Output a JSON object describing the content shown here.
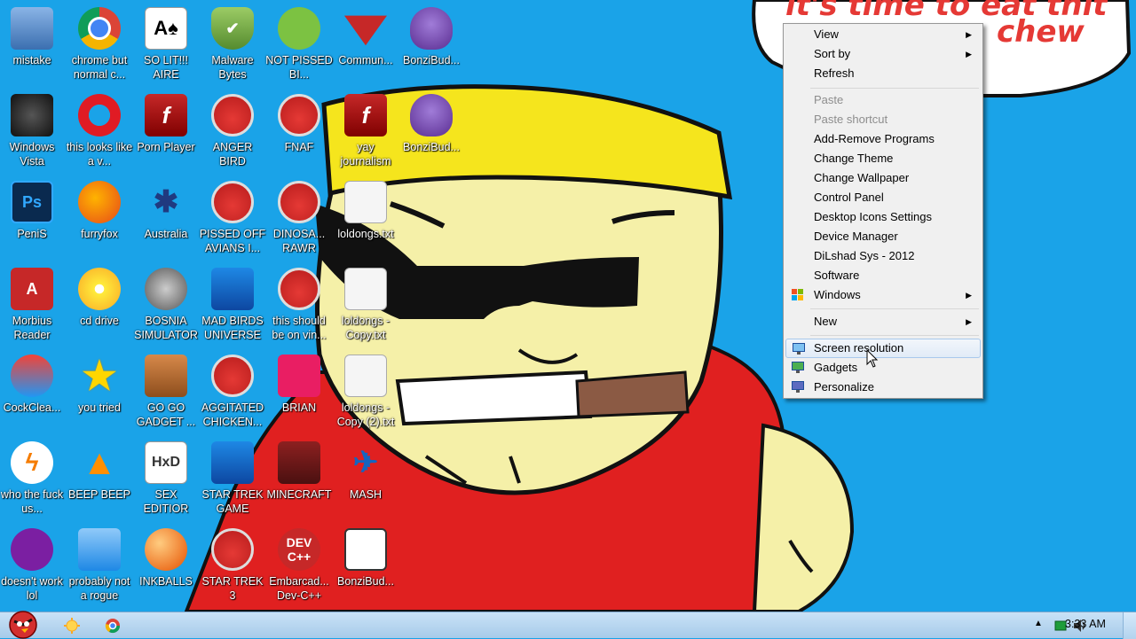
{
  "wallpaper": {
    "speech_line1": "it's time to eat thit",
    "speech_line2": "chew"
  },
  "desktop_icons": [
    {
      "label": "mistake"
    },
    {
      "label": "chrome but normal c..."
    },
    {
      "label": "SO LIT!!! AIRE"
    },
    {
      "label": "Malware Bytes"
    },
    {
      "label": "NOT PISSED BI..."
    },
    {
      "label": "Commun..."
    },
    {
      "label": "BonziBud..."
    },
    {
      "label": "Windows Vista"
    },
    {
      "label": "this looks like a v..."
    },
    {
      "label": "Porn Player"
    },
    {
      "label": "ANGER BIRD"
    },
    {
      "label": "FNAF"
    },
    {
      "label": "yay journalism"
    },
    {
      "label": "BonziBud..."
    },
    {
      "label": "PeniS"
    },
    {
      "label": "furryfox"
    },
    {
      "label": "Australia"
    },
    {
      "label": "PISSED OFF AVIANS I..."
    },
    {
      "label": "DINOSA... RAWR"
    },
    {
      "label": "loldongs.txt"
    },
    {
      "label": "Morbius Reader"
    },
    {
      "label": "cd drive"
    },
    {
      "label": "BOSNIA SIMULATOR"
    },
    {
      "label": "MAD BIRDS UNIVERSE"
    },
    {
      "label": "this should be on vin..."
    },
    {
      "label": "loldongs - Copy.txt"
    },
    {
      "label": "CockClea..."
    },
    {
      "label": "you tried"
    },
    {
      "label": "GO GO GADGET ..."
    },
    {
      "label": "AGGITATED CHICKEN..."
    },
    {
      "label": "BRIAN"
    },
    {
      "label": "loldongs - Copy (2).txt"
    },
    {
      "label": "who the fuck us..."
    },
    {
      "label": "BEEP BEEP"
    },
    {
      "label": "SEX EDITIOR"
    },
    {
      "label": "STAR TREK GAME"
    },
    {
      "label": "MINECRAFT"
    },
    {
      "label": "MASH"
    },
    {
      "label": "doesn't work lol"
    },
    {
      "label": "probably not a rogue"
    },
    {
      "label": "INKBALLS"
    },
    {
      "label": "STAR TREK 3"
    },
    {
      "label": "Embarcad... Dev-C++"
    },
    {
      "label": "BonziBud..."
    }
  ],
  "icon_glyphs": {
    "ps": "Ps",
    "pdf": "A",
    "hxd": "HxD",
    "dev": "DEV C++",
    "card": "A♠",
    "star": "★",
    "cone": "▲",
    "lightning": "ϟ",
    "flash": "f",
    "spider": "✱",
    "ship": "✈"
  },
  "context_menu": {
    "view": "View",
    "sort_by": "Sort by",
    "refresh": "Refresh",
    "paste": "Paste",
    "paste_shortcut": "Paste shortcut",
    "add_remove": "Add-Remove Programs",
    "change_theme": "Change Theme",
    "change_wallpaper": "Change Wallpaper",
    "control_panel": "Control Panel",
    "desktop_icons_settings": "Desktop Icons Settings",
    "device_manager": "Device Manager",
    "dilshad": "DiLshad Sys - 2012",
    "software": "Software",
    "windows": "Windows",
    "new": "New",
    "screen_resolution": "Screen resolution",
    "gadgets": "Gadgets",
    "personalize": "Personalize"
  },
  "taskbar": {
    "clock": "3:33 AM"
  },
  "colors": {
    "desktop_bg": "#1aa3e8",
    "menu_bg": "#f0f0f0",
    "hover": "#e1ebf7"
  }
}
